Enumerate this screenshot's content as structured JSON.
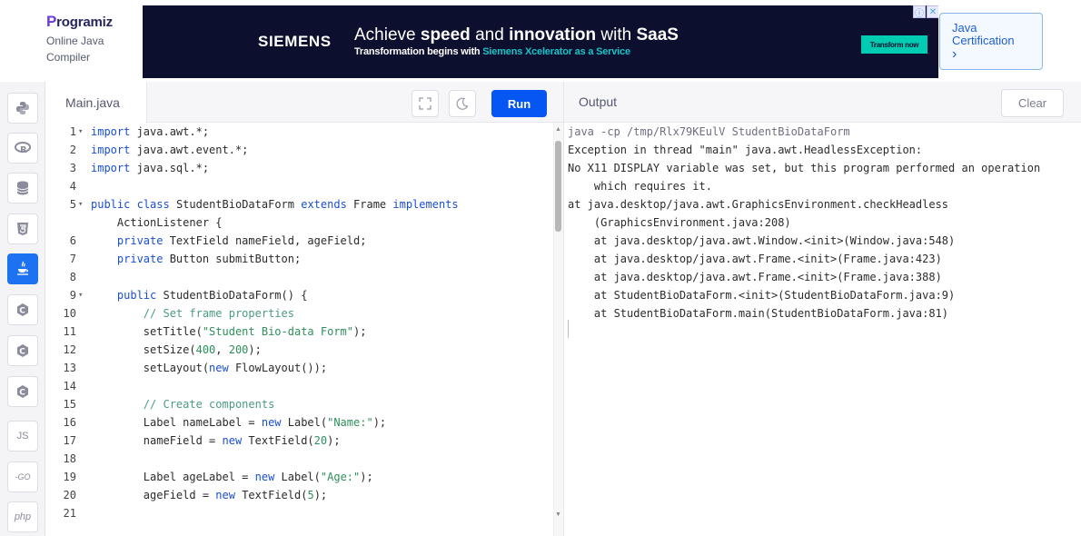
{
  "header": {
    "brand_name": "rogramiz",
    "brand_mark": "P",
    "brand_line1": "Online Java",
    "brand_line2": "Compiler"
  },
  "ad": {
    "siemens": "SIEMENS",
    "headline_pre": "Achieve ",
    "headline_b1": "speed",
    "headline_mid": " and ",
    "headline_b2": "innovation",
    "headline_mid2": " with ",
    "headline_b3": "SaaS",
    "sub_pre": "Transformation begins with ",
    "sub_accent": "Siemens Xcelerator as a Service",
    "cta": "Transform now",
    "colors": {
      "background": "#0c0f2e",
      "accent": "#19c3c7",
      "cta": "#00ccb4"
    }
  },
  "certification": {
    "line1": "Java",
    "line2": "Certification",
    "arrow": "›"
  },
  "sidebar": {
    "items": [
      {
        "icon": "python-icon",
        "active": false
      },
      {
        "icon": "r-icon",
        "active": false
      },
      {
        "icon": "sql-database-icon",
        "active": false
      },
      {
        "icon": "html5-icon",
        "active": false
      },
      {
        "icon": "java-icon",
        "active": true
      },
      {
        "icon": "c-icon",
        "active": false
      },
      {
        "icon": "cpp-icon",
        "active": false
      },
      {
        "icon": "csharp-icon",
        "active": false
      },
      {
        "icon": "javascript-icon",
        "label": "JS",
        "active": false
      },
      {
        "icon": "go-icon",
        "label": "-GO",
        "active": false
      },
      {
        "icon": "php-icon",
        "label": "php",
        "active": false
      }
    ]
  },
  "editor": {
    "tab_label": "Main.java",
    "run_label": "Run",
    "fullscreen_icon": "fullscreen-icon",
    "theme_icon": "moon-icon"
  },
  "code_lines": [
    {
      "n": "1",
      "fold": true,
      "html": "<span class='kw'>import</span> java.awt.*;"
    },
    {
      "n": "2",
      "fold": false,
      "html": "<span class='kw'>import</span> java.awt.event.*;"
    },
    {
      "n": "3",
      "fold": false,
      "html": "<span class='kw'>import</span> java.sql.*;"
    },
    {
      "n": "4",
      "fold": false,
      "html": ""
    },
    {
      "n": "5",
      "fold": true,
      "html": "<span class='kw'>public</span> <span class='kw'>class</span> StudentBioDataForm <span class='kw'>extends</span> Frame <span class='kw'>implements</span>"
    },
    {
      "n": "",
      "fold": false,
      "html": "    ActionListener {"
    },
    {
      "n": "6",
      "fold": false,
      "html": "    <span class='kw'>private</span> TextField nameField, ageField;"
    },
    {
      "n": "7",
      "fold": false,
      "html": "    <span class='kw'>private</span> Button submitButton;"
    },
    {
      "n": "8",
      "fold": false,
      "html": ""
    },
    {
      "n": "9",
      "fold": true,
      "html": "    <span class='kw'>public</span> StudentBioDataForm() {"
    },
    {
      "n": "10",
      "fold": false,
      "html": "        <span class='cm'>// Set frame properties</span>"
    },
    {
      "n": "11",
      "fold": false,
      "html": "        setTitle(<span class='str'>\"Student Bio-data Form\"</span>);"
    },
    {
      "n": "12",
      "fold": false,
      "html": "        setSize(<span class='str'>400</span>, <span class='str'>200</span>);"
    },
    {
      "n": "13",
      "fold": false,
      "html": "        setLayout(<span class='kw'>new</span> FlowLayout());"
    },
    {
      "n": "14",
      "fold": false,
      "html": ""
    },
    {
      "n": "15",
      "fold": false,
      "html": "        <span class='cm'>// Create components</span>"
    },
    {
      "n": "16",
      "fold": false,
      "html": "        Label nameLabel = <span class='kw'>new</span> Label(<span class='str'>\"Name:\"</span>);"
    },
    {
      "n": "17",
      "fold": false,
      "html": "        nameField = <span class='kw'>new</span> TextField(<span class='str'>20</span>);"
    },
    {
      "n": "18",
      "fold": false,
      "html": ""
    },
    {
      "n": "19",
      "fold": false,
      "html": "        Label ageLabel = <span class='kw'>new</span> Label(<span class='str'>\"Age:\"</span>);"
    },
    {
      "n": "20",
      "fold": false,
      "html": "        ageField = <span class='kw'>new</span> TextField(<span class='str'>5</span>);"
    },
    {
      "n": "21",
      "fold": false,
      "html": ""
    }
  ],
  "output": {
    "title": "Output",
    "clear_label": "Clear",
    "lines": [
      {
        "text": "java -cp /tmp/Rlx79KEulV StudentBioDataForm",
        "cmd": true
      },
      {
        "text": "Exception in thread \"main\" java.awt.HeadlessException:",
        "cmd": false
      },
      {
        "text": "No X11 DISPLAY variable was set, but this program performed an operation",
        "cmd": false
      },
      {
        "text": "    which requires it.",
        "cmd": false
      },
      {
        "text": "at java.desktop/java.awt.GraphicsEnvironment.checkHeadless",
        "cmd": false
      },
      {
        "text": "    (GraphicsEnvironment.java:208)",
        "cmd": false
      },
      {
        "text": "    at java.desktop/java.awt.Window.<init>(Window.java:548)",
        "cmd": false
      },
      {
        "text": "    at java.desktop/java.awt.Frame.<init>(Frame.java:423)",
        "cmd": false
      },
      {
        "text": "    at java.desktop/java.awt.Frame.<init>(Frame.java:388)",
        "cmd": false
      },
      {
        "text": "    at StudentBioDataForm.<init>(StudentBioDataForm.java:9)",
        "cmd": false
      },
      {
        "text": "    at StudentBioDataForm.main(StudentBioDataForm.java:81)",
        "cmd": false
      }
    ]
  }
}
